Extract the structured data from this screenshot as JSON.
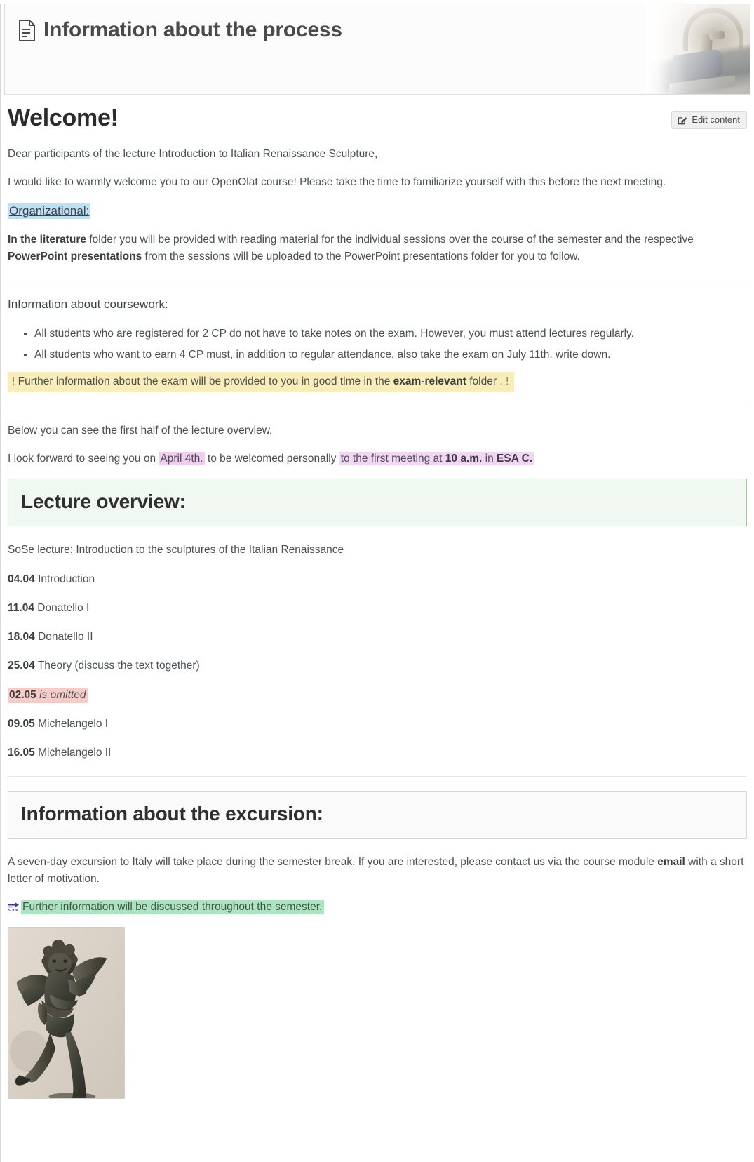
{
  "banner": {
    "title": "Information about the process",
    "icon": "document-icon",
    "photo_alt": "faded-sculpture-photo"
  },
  "toolbar": {
    "edit_label": "Edit content",
    "edit_icon": "pencil-square-icon"
  },
  "main": {
    "heading": "Welcome!",
    "greeting": "Dear participants of the lecture Introduction to Italian Renaissance Sculpture,",
    "intro": "I would like to warmly welcome you to our OpenOlat course! Please take the time to familiarize yourself with this before the next meeting.",
    "organizational_heading": "Organizational:",
    "organizational_bold_1": "In the literature",
    "organizational_text_1": " folder you will be provided with reading material for the individual sessions over the course of the semester and  the respective ",
    "organizational_bold_2": "PowerPoint presentations",
    "organizational_text_2": " from the sessions will be uploaded to the PowerPoint presentations folder for you to follow.",
    "coursework_heading": "Information about coursework:",
    "coursework_bullets": [
      "All students who are registered for 2 CP do not have to take notes on the exam. However, you must attend lectures regularly.",
      "All students who want to earn 4 CP must, in addition to regular attendance, also take the exam on July 11th. write down."
    ],
    "exam_notice_mark_left": "!",
    "exam_notice_text_1": "Further information about the exam will be provided to you in good time in the ",
    "exam_notice_bold": "exam-relevant",
    "exam_notice_text_2": " folder . ",
    "exam_notice_mark_right": "!",
    "below_note": "Below you can see the first half of the lecture overview.",
    "closing_text_1": "I look forward to seeing you on ",
    "closing_hl_1": "April 4th.",
    "closing_text_2": " to be welcomed personally ",
    "closing_hl_2a": "to the first meeting at ",
    "closing_hl_2b": "10 a.m.",
    "closing_hl_2c": " in ",
    "closing_hl_2d": "ESA C."
  },
  "lecture_overview": {
    "heading": "Lecture overview:",
    "subtitle": "SoSe lecture: Introduction to the sculptures of the Italian Renaissance",
    "sessions": [
      {
        "date": "04.04",
        "topic": "Introduction",
        "highlight": "none",
        "italic": false
      },
      {
        "date": "11.04",
        "topic": "Donatello I",
        "highlight": "none",
        "italic": false
      },
      {
        "date": "18.04",
        "topic": "Donatello II",
        "highlight": "none",
        "italic": false
      },
      {
        "date": "25.04",
        "topic": "Theory (discuss the text together)",
        "highlight": "none",
        "italic": false
      },
      {
        "date": "02.05",
        "topic": "is omitted",
        "highlight": "red",
        "italic": true
      },
      {
        "date": "09.05",
        "topic": "Michelangelo I",
        "highlight": "none",
        "italic": false
      },
      {
        "date": "16.05",
        "topic": "Michelangelo II",
        "highlight": "none",
        "italic": false
      }
    ]
  },
  "excursion": {
    "heading": "Information about the excursion:",
    "text_1": "A seven-day excursion to Italy will take place during the semester break. If you are interested, please contact us via the course module ",
    "bold": "email",
    "text_2": " with a short letter of motivation.",
    "soon_icon": "soon-arrow-emoji",
    "soon_text": "Further information will be discussed throughout the semester.",
    "image_alt": "putto-with-dolphin-bronze-sculpture"
  },
  "colors": {
    "highlight_blue": "#bde0f2",
    "highlight_yellow": "#faeeb8",
    "highlight_pink": "#f1cef0",
    "highlight_red": "#f8ccc6",
    "highlight_green": "#a8e6bd",
    "callout_green_border": "#9ec89e",
    "callout_green_bg": "#f1f8f1",
    "callout_grey_bg": "#fafafa",
    "text": "#4b4f53"
  }
}
